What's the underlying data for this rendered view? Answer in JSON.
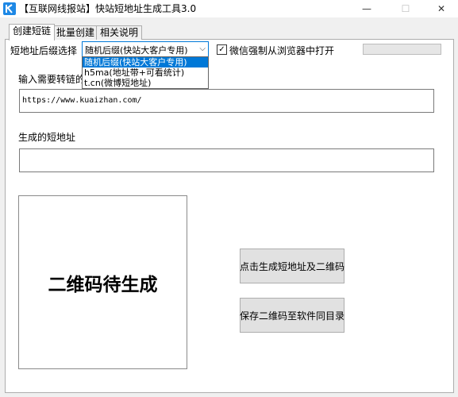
{
  "window": {
    "title": "【互联网线报站】快站短地址生成工具3.0",
    "minimize_glyph": "—",
    "maximize_glyph": "☐",
    "close_glyph": "✕",
    "icon": "app-k-logo-icon",
    "accent_color": "#0078d7"
  },
  "tabs": [
    {
      "label": "创建短链",
      "active": true
    },
    {
      "label": "批量创建",
      "active": false
    },
    {
      "label": "相关说明",
      "active": false
    }
  ],
  "suffix": {
    "label": "短地址后缀选择",
    "selected": "随机后缀(快站大客户专用)",
    "options": [
      "随机后缀(快站大客户专用)",
      "h5ma(地址带+可看统计)",
      "t.cn(微博短地址)"
    ]
  },
  "wechat_checkbox": {
    "label": "微信强制从浏览器中打开",
    "checked": true,
    "check_glyph": "✓"
  },
  "long_url": {
    "label": "输入需要转链的网",
    "value": "https://www.kuaizhan.com/"
  },
  "short_url": {
    "label": "生成的短地址",
    "value": ""
  },
  "qr": {
    "placeholder": "二维码待生成"
  },
  "buttons": {
    "generate": "点击生成短地址及二维码",
    "save_qr": "保存二维码至软件同目录"
  }
}
